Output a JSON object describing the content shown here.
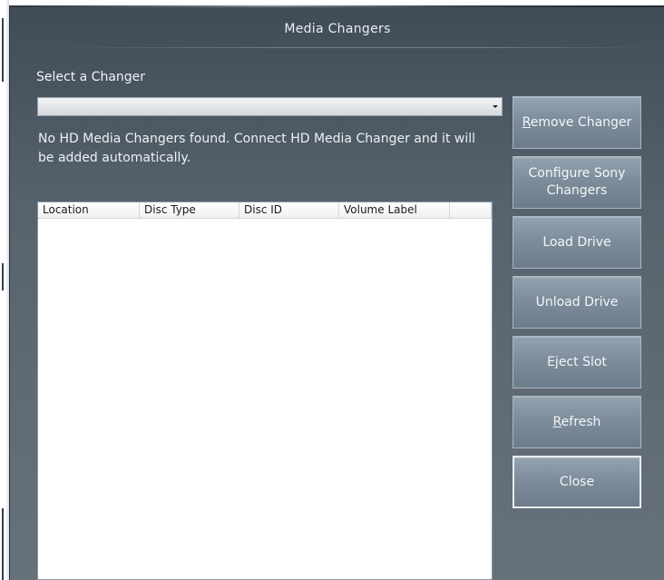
{
  "window": {
    "title": "Media Changers"
  },
  "changer": {
    "label": "Select a Changer",
    "selected": "",
    "message": "No HD Media Changers found.  Connect HD Media Changer and it will be added automatically."
  },
  "table": {
    "columns": [
      "Location",
      "Disc Type",
      "Disc ID",
      "Volume Label",
      ""
    ],
    "rows": []
  },
  "buttons": {
    "remove_changer": {
      "mnemonic": "R",
      "rest": "emove Changer"
    },
    "configure_sony": "Configure Sony Changers",
    "load_drive": "Load Drive",
    "unload_drive": "Unload Drive",
    "eject_slot": "Eject Slot",
    "refresh": {
      "mnemonic": "R",
      "rest": "efresh"
    },
    "close": "Close"
  },
  "colors": {
    "dialog_top": "#3f4c58",
    "dialog_bottom": "#66717b",
    "button_face": "#7d8d9b"
  }
}
